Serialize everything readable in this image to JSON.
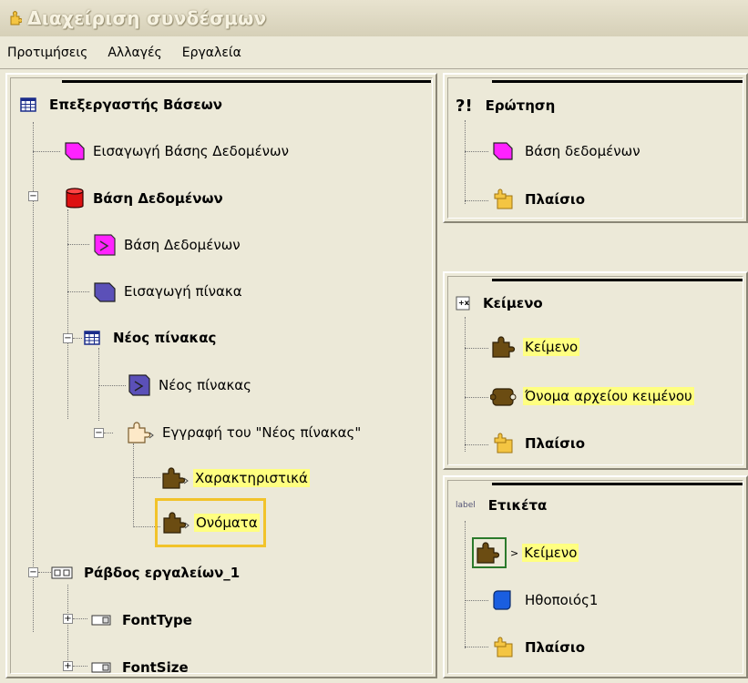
{
  "window": {
    "title": "Διαχείριση συνδέσμων"
  },
  "menu": [
    "Προτιμήσεις",
    "Αλλαγές",
    "Εργαλεία"
  ],
  "left_tree": {
    "root": "Επεξεργαστής Βάσεων",
    "items": [
      "Εισαγωγή Βάσης Δεδομένων",
      "Βάση Δεδομένων",
      "Βάση Δεδομένων",
      "Εισαγωγή πίνακα",
      "Νέος πίνακας",
      "Νέος πίνακας",
      "Εγγραφή του \"Νέος πίνακας\"",
      "Χαρακτηριστικά",
      "Ονόματα",
      "Ράβδος εργαλείων_1",
      "FontType",
      "FontSize"
    ]
  },
  "query_panel": {
    "title": "Ερώτηση",
    "icon_text": "?!",
    "items": [
      "Βάση δεδομένων",
      "Πλαίσιο"
    ]
  },
  "text_panel": {
    "title": "Κείμενο",
    "items": [
      "Κείμενο",
      "Όνομα αρχείου κειμένου",
      "Πλαίσιο"
    ]
  },
  "label_panel": {
    "title": "Ετικέτα",
    "items": [
      "Κείμενο",
      "Ηθοποιός1",
      "Πλαίσιο"
    ]
  },
  "colors": {
    "highlight": "#ffff80",
    "selection": "#f2c32a",
    "magenta": "#ff22ff",
    "blue": "#1a5ee0",
    "puzzle": "#6b4c12"
  }
}
